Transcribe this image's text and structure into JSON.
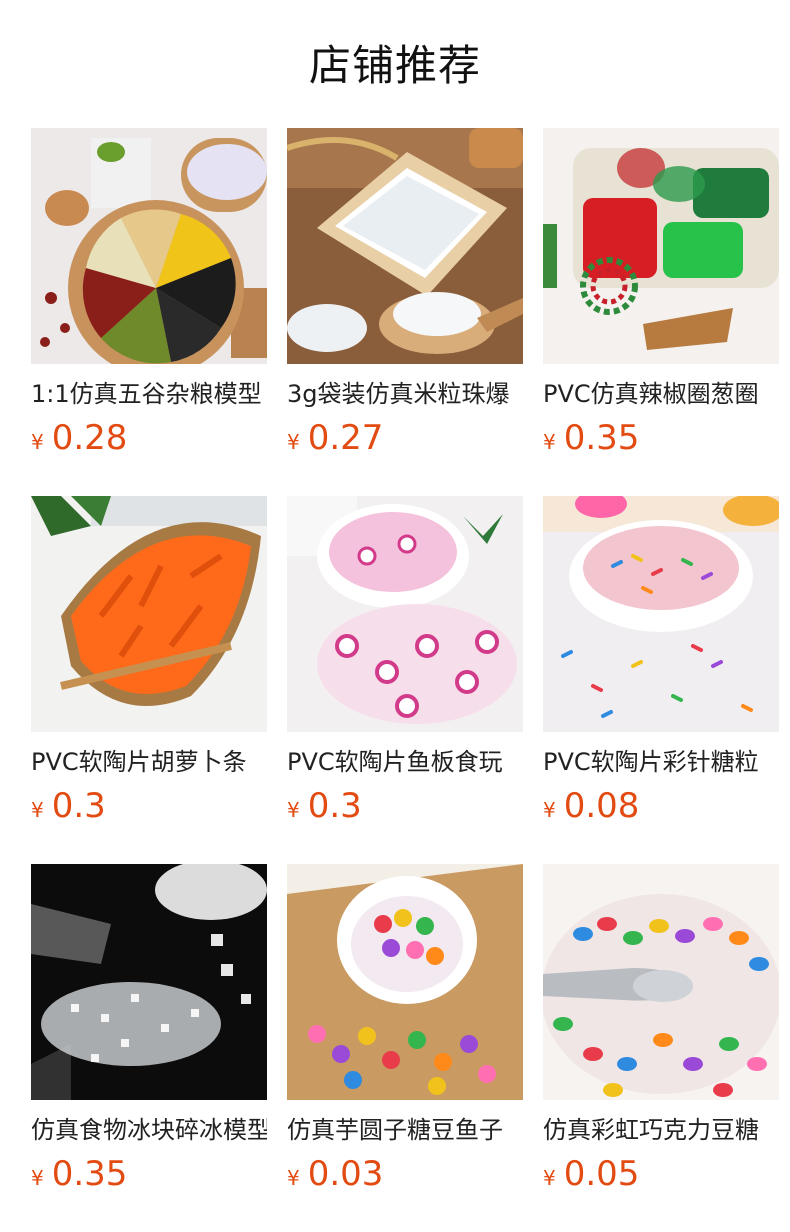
{
  "header": {
    "title": "店铺推荐"
  },
  "products": [
    {
      "name": "1:1仿真五谷杂粮模型",
      "currency": "¥",
      "price": "0.28",
      "image": "grain-model-photo"
    },
    {
      "name": "3g袋装仿真米粒珠爆",
      "currency": "¥",
      "price": "0.27",
      "image": "rice-beads-photo"
    },
    {
      "name": "PVC仿真辣椒圈葱圈",
      "currency": "¥",
      "price": "0.35",
      "image": "pepper-rings-photo"
    },
    {
      "name": "PVC软陶片胡萝卜条",
      "currency": "¥",
      "price": "0.3",
      "image": "carrot-strips-photo"
    },
    {
      "name": "PVC软陶片鱼板食玩",
      "currency": "¥",
      "price": "0.3",
      "image": "fishcake-slices-photo"
    },
    {
      "name": "PVC软陶片彩针糖粒",
      "currency": "¥",
      "price": "0.08",
      "image": "sprinkles-photo"
    },
    {
      "name": "仿真食物冰块碎冰模型",
      "currency": "¥",
      "price": "0.35",
      "image": "crushed-ice-photo"
    },
    {
      "name": "仿真芋圆子糖豆鱼子",
      "currency": "¥",
      "price": "0.03",
      "image": "taro-balls-photo"
    },
    {
      "name": "仿真彩虹巧克力豆糖",
      "currency": "¥",
      "price": "0.05",
      "image": "rainbow-beans-photo"
    }
  ]
}
